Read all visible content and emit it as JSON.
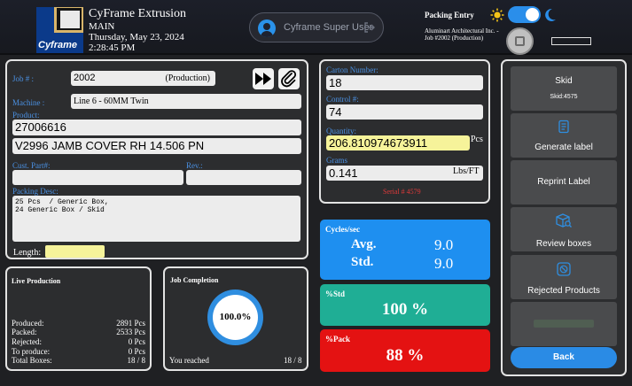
{
  "header": {
    "logo_text": "Cyframe",
    "company": "CyFrame Extrusion",
    "plant": "MAIN",
    "date": "Thursday, May 23, 2024",
    "time": "2:28:45 PM",
    "user": "Cyframe Super User",
    "mode_title": "Packing Entry",
    "job_info": "Aluminart Architectural Inc. - Job #2002 (Production)",
    "theme": "dark"
  },
  "job": {
    "job_label": "Job # :",
    "job_number": "2002",
    "job_type": "(Production)",
    "machine_label": "Machine :",
    "machine": "Line 6 - 60MM Twin",
    "product_label": "Product:",
    "product_code": "27006616",
    "product_desc": "V2996 JAMB COVER RH 14.506 PN",
    "cust_part_label": "Cust. Part#:",
    "cust_part": "",
    "rev_label": "Rev.:",
    "rev": "",
    "packing_desc_label": "Packing Desc:",
    "packing_desc": "25 Pcs  / Generic Box,\n24 Generic Box / Skid",
    "length_label": "Length:",
    "length": ""
  },
  "live": {
    "title": "Live Production",
    "rows": [
      {
        "label": "Produced:",
        "value": "2891 Pcs"
      },
      {
        "label": "Packed:",
        "value": "2533 Pcs"
      },
      {
        "label": "Rejected:",
        "value": "0 Pcs"
      },
      {
        "label": "To produce:",
        "value": "0 Pcs"
      },
      {
        "label": "Total Boxes:",
        "value": "18 / 8"
      }
    ]
  },
  "completion": {
    "title": "Job Completion",
    "percent": "100.0%",
    "reached_label": "You reached",
    "reached_value": "18 / 8"
  },
  "carton": {
    "carton_label": "Carton Number:",
    "carton": "18",
    "control_label": "Control #:",
    "control": "74",
    "quantity_label": "Quantity:",
    "quantity": "206.810974673911",
    "quantity_unit": "Pcs",
    "grams_label": "Grams",
    "grams": "0.141",
    "grams_unit": "Lbs/FT",
    "serial": "Serial # 4579"
  },
  "stats": {
    "cycles_title": "Cycles/sec",
    "avg_label": "Avg.",
    "avg_value": "9.0",
    "std_label": "Std.",
    "std_value": "9.0",
    "pct_std_title": "%Std",
    "pct_std": "100 %",
    "pct_pack_title": "%Pack",
    "pct_pack": "88 %",
    "colors": {
      "cycles": "#1e8ff0",
      "std": "#1fae95",
      "pack": "#e41212"
    }
  },
  "actions": {
    "skid_label": "Skid",
    "skid_id": "Skid:4575",
    "generate": "Generate label",
    "reprint": "Reprint Label",
    "review": "Review boxes",
    "rejected": "Rejected Products",
    "back": "Back"
  }
}
